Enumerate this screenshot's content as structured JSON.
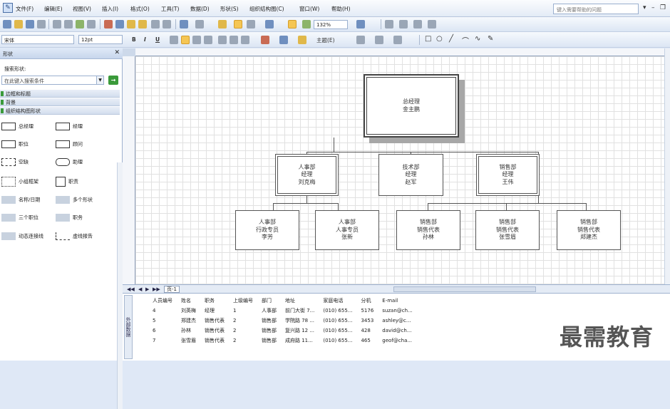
{
  "menubar": {
    "items": [
      "文件(F)",
      "编辑(E)",
      "视图(V)",
      "插入(I)",
      "格式(O)",
      "工具(T)",
      "数据(D)",
      "形状(S)",
      "组织结构图(C)",
      "窗口(W)",
      "帮助(H)"
    ],
    "help_placeholder": "键入需要帮助的问题"
  },
  "toolbar": {
    "zoom": "132%",
    "font_name": "宋体",
    "font_size": "12pt",
    "theme_label": "主题(E)"
  },
  "shapes_panel": {
    "title": "形状",
    "search_label": "搜索形状:",
    "search_placeholder": "在此键入搜索条件",
    "stencils": [
      "边框和标题",
      "背景",
      "组织结构图形状"
    ],
    "items": [
      [
        "总经理",
        "经理"
      ],
      [
        "职位",
        "顾问"
      ],
      [
        "空缺",
        "助理"
      ],
      [
        "小组框架",
        "职责"
      ],
      [
        "名称/日期",
        "多个形状"
      ],
      [
        "三个职位",
        "职务"
      ],
      [
        "动态连接线",
        "虚线报告"
      ]
    ]
  },
  "org_chart": {
    "top": [
      "总经理",
      "金主鹏"
    ],
    "mid": [
      [
        "人事部",
        "经理",
        "刘克梅"
      ],
      [
        "技术部",
        "经理",
        "赵军"
      ],
      [
        "销售部",
        "经理",
        "王伟"
      ]
    ],
    "bottom": [
      [
        "人事部",
        "行政专员",
        "李芳"
      ],
      [
        "人事部",
        "人事专员",
        "张新"
      ],
      [
        "销售部",
        "销售代表",
        "孙林"
      ],
      [
        "销售部",
        "销售代表",
        "张雪眉"
      ],
      [
        "销售部",
        "销售代表",
        "郑建杰"
      ]
    ]
  },
  "page_tab": "页-1",
  "external_data": {
    "label": "外部数据",
    "columns": [
      "人员编号",
      "姓名",
      "职务",
      "上级编号",
      "部门",
      "地址",
      "家庭电话",
      "分机",
      "E-mail"
    ],
    "rows": [
      [
        "4",
        "刘英梅",
        "经理",
        "1",
        "人事部",
        "前门大街 7...",
        "(010) 655...",
        "5176",
        "suzan@ch..."
      ],
      [
        "5",
        "郑建杰",
        "销售代表",
        "2",
        "销售部",
        "学院路 78 ...",
        "(010) 655...",
        "3453",
        "ashley@c..."
      ],
      [
        "6",
        "孙林",
        "销售代表",
        "2",
        "销售部",
        "复兴路 12 ...",
        "(010) 655...",
        "428",
        "david@ch..."
      ],
      [
        "7",
        "张雪眉",
        "销售代表",
        "2",
        "销售部",
        "成府路 11...",
        "(010) 655...",
        "465",
        "geof@cha..."
      ]
    ]
  },
  "watermark": "最需教育"
}
